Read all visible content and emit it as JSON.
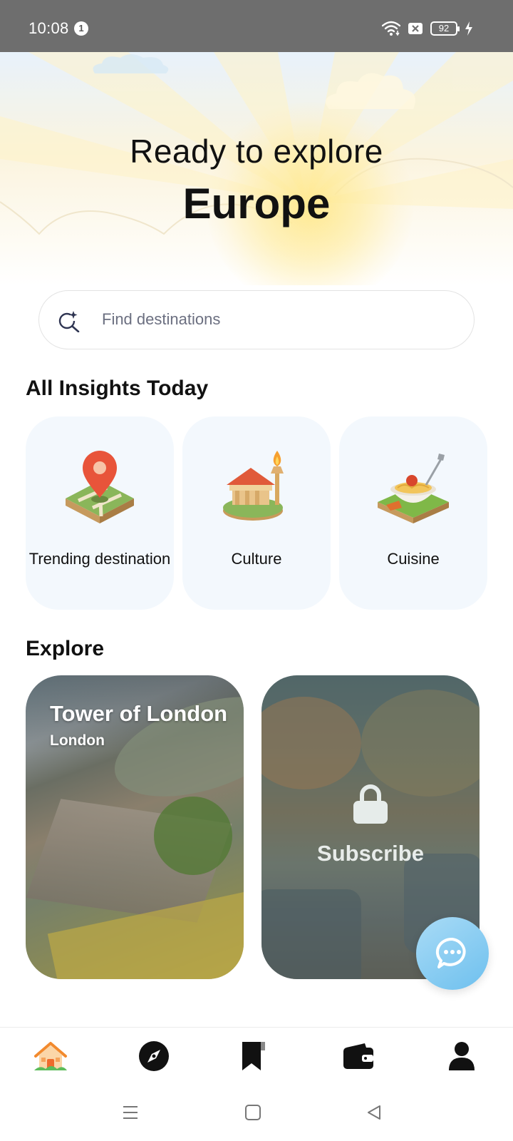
{
  "status_bar": {
    "time": "10:08",
    "notification_count": "1",
    "battery_level": "92"
  },
  "hero": {
    "title": "Ready to explore",
    "subtitle": "Europe"
  },
  "search": {
    "placeholder": "Find destinations"
  },
  "insights": {
    "title": "All Insights Today",
    "items": [
      {
        "label": "Trending destination",
        "icon": "map-pin-icon"
      },
      {
        "label": "Culture",
        "icon": "temple-torch-icon"
      },
      {
        "label": "Cuisine",
        "icon": "pasta-bowl-icon"
      }
    ]
  },
  "explore": {
    "title": "Explore",
    "cards": [
      {
        "title": "Tower of London",
        "subtitle": "London",
        "locked": false
      },
      {
        "label": "Subscribe",
        "locked": true
      }
    ]
  },
  "bottom_nav": {
    "items": [
      {
        "icon": "home-icon",
        "active": true
      },
      {
        "icon": "compass-icon",
        "active": false
      },
      {
        "icon": "bookmark-icon",
        "active": false
      },
      {
        "icon": "wallet-icon",
        "active": false
      },
      {
        "icon": "profile-icon",
        "active": false
      }
    ]
  },
  "colors": {
    "status_bar": "#6e6e6e",
    "card_background": "#f3f8fd",
    "chat_button": "#6ec0ee",
    "accent_home": "#f28a2e"
  }
}
